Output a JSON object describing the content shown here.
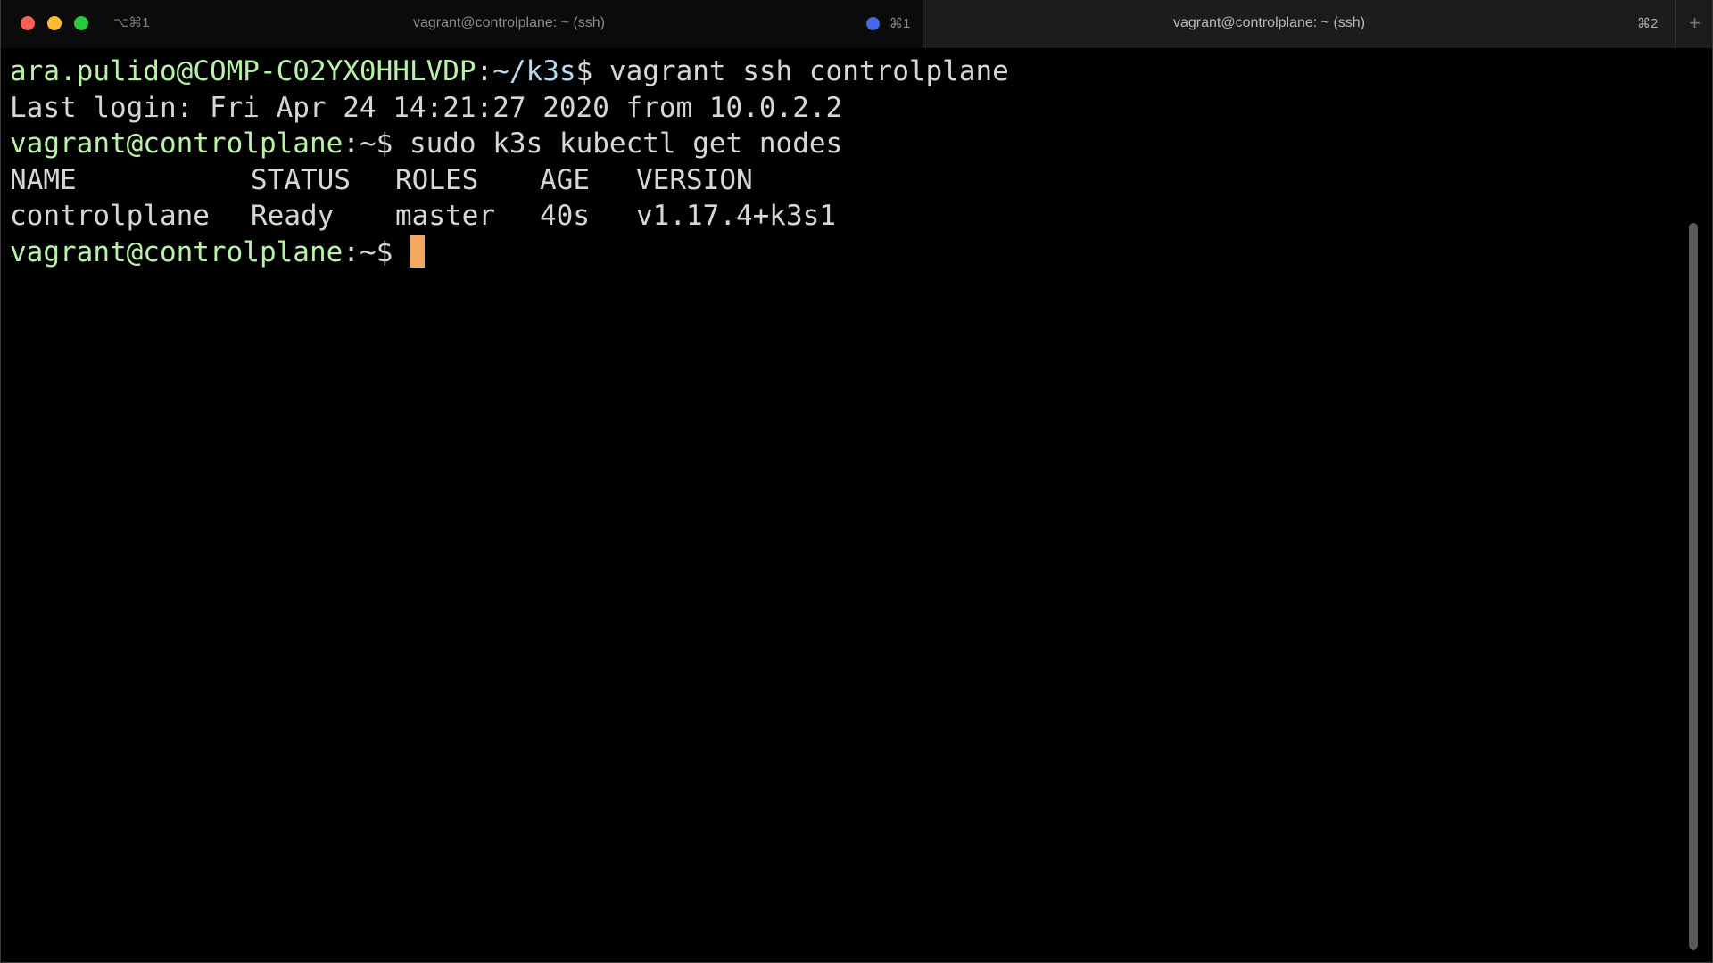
{
  "colors": {
    "traffic_close": "#ff5f57",
    "traffic_minimize": "#febc2e",
    "traffic_zoom": "#28c840",
    "activity_dot": "#4468e8",
    "prompt_green": "#b9f2a6",
    "path_blue": "#b8d9f0",
    "cursor_orange": "#f2a85e"
  },
  "tabs": [
    {
      "shortcut_left": "⌥⌘1",
      "title": "vagrant@controlplane: ~ (ssh)",
      "shortcut": "⌘1",
      "active": true
    },
    {
      "title": "vagrant@controlplane: ~ (ssh)",
      "shortcut": "⌘2",
      "active": false
    }
  ],
  "new_tab_icon": "plus-icon",
  "new_tab_glyph": "+",
  "terminal": {
    "line1": {
      "prompt": "ara.pulido@COMP-C02YX0HHLVDP",
      "sep": ":",
      "path": "~/k3s",
      "dollar": "$ ",
      "command": "vagrant ssh controlplane"
    },
    "line2": "Last login: Fri Apr 24 14:21:27 2020 from 10.0.2.2",
    "line3": {
      "prompt": "vagrant@controlplane",
      "sep": ":~",
      "dollar": "$ ",
      "command": "sudo k3s kubectl get nodes"
    },
    "nodes_table": {
      "headers": [
        "NAME",
        "STATUS",
        "ROLES",
        "AGE",
        "VERSION"
      ],
      "rows": [
        [
          "controlplane",
          "Ready",
          "master",
          "40s",
          "v1.17.4+k3s1"
        ]
      ]
    },
    "line6": {
      "prompt": "vagrant@controlplane",
      "sep": ":~",
      "dollar": "$ "
    }
  }
}
